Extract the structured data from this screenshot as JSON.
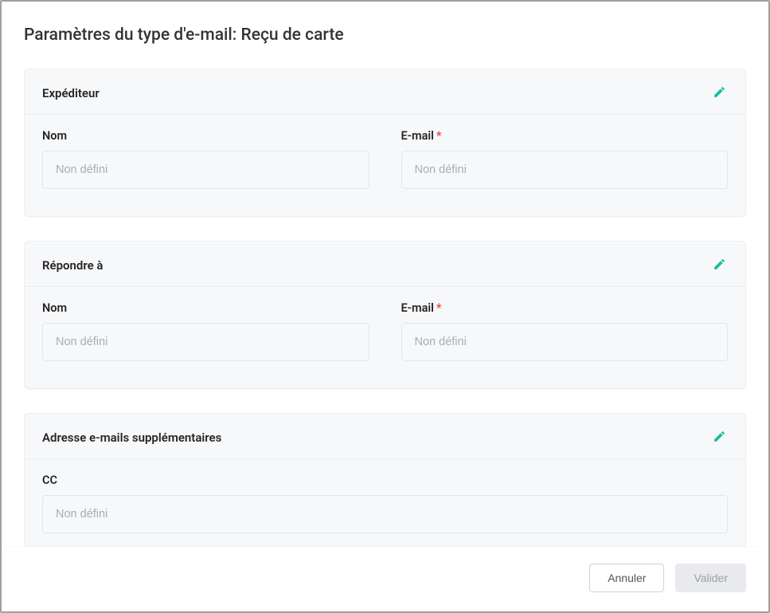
{
  "title": "Paramètres du type d'e-mail: Reçu de carte",
  "placeholder_undefined": "Non défini",
  "sections": {
    "sender": {
      "title": "Expéditeur",
      "name_label": "Nom",
      "email_label": "E-mail"
    },
    "reply_to": {
      "title": "Répondre à",
      "name_label": "Nom",
      "email_label": "E-mail"
    },
    "additional": {
      "title": "Adresse e-mails supplémentaires",
      "cc_label": "CC"
    }
  },
  "footer": {
    "cancel": "Annuler",
    "submit": "Valider"
  }
}
